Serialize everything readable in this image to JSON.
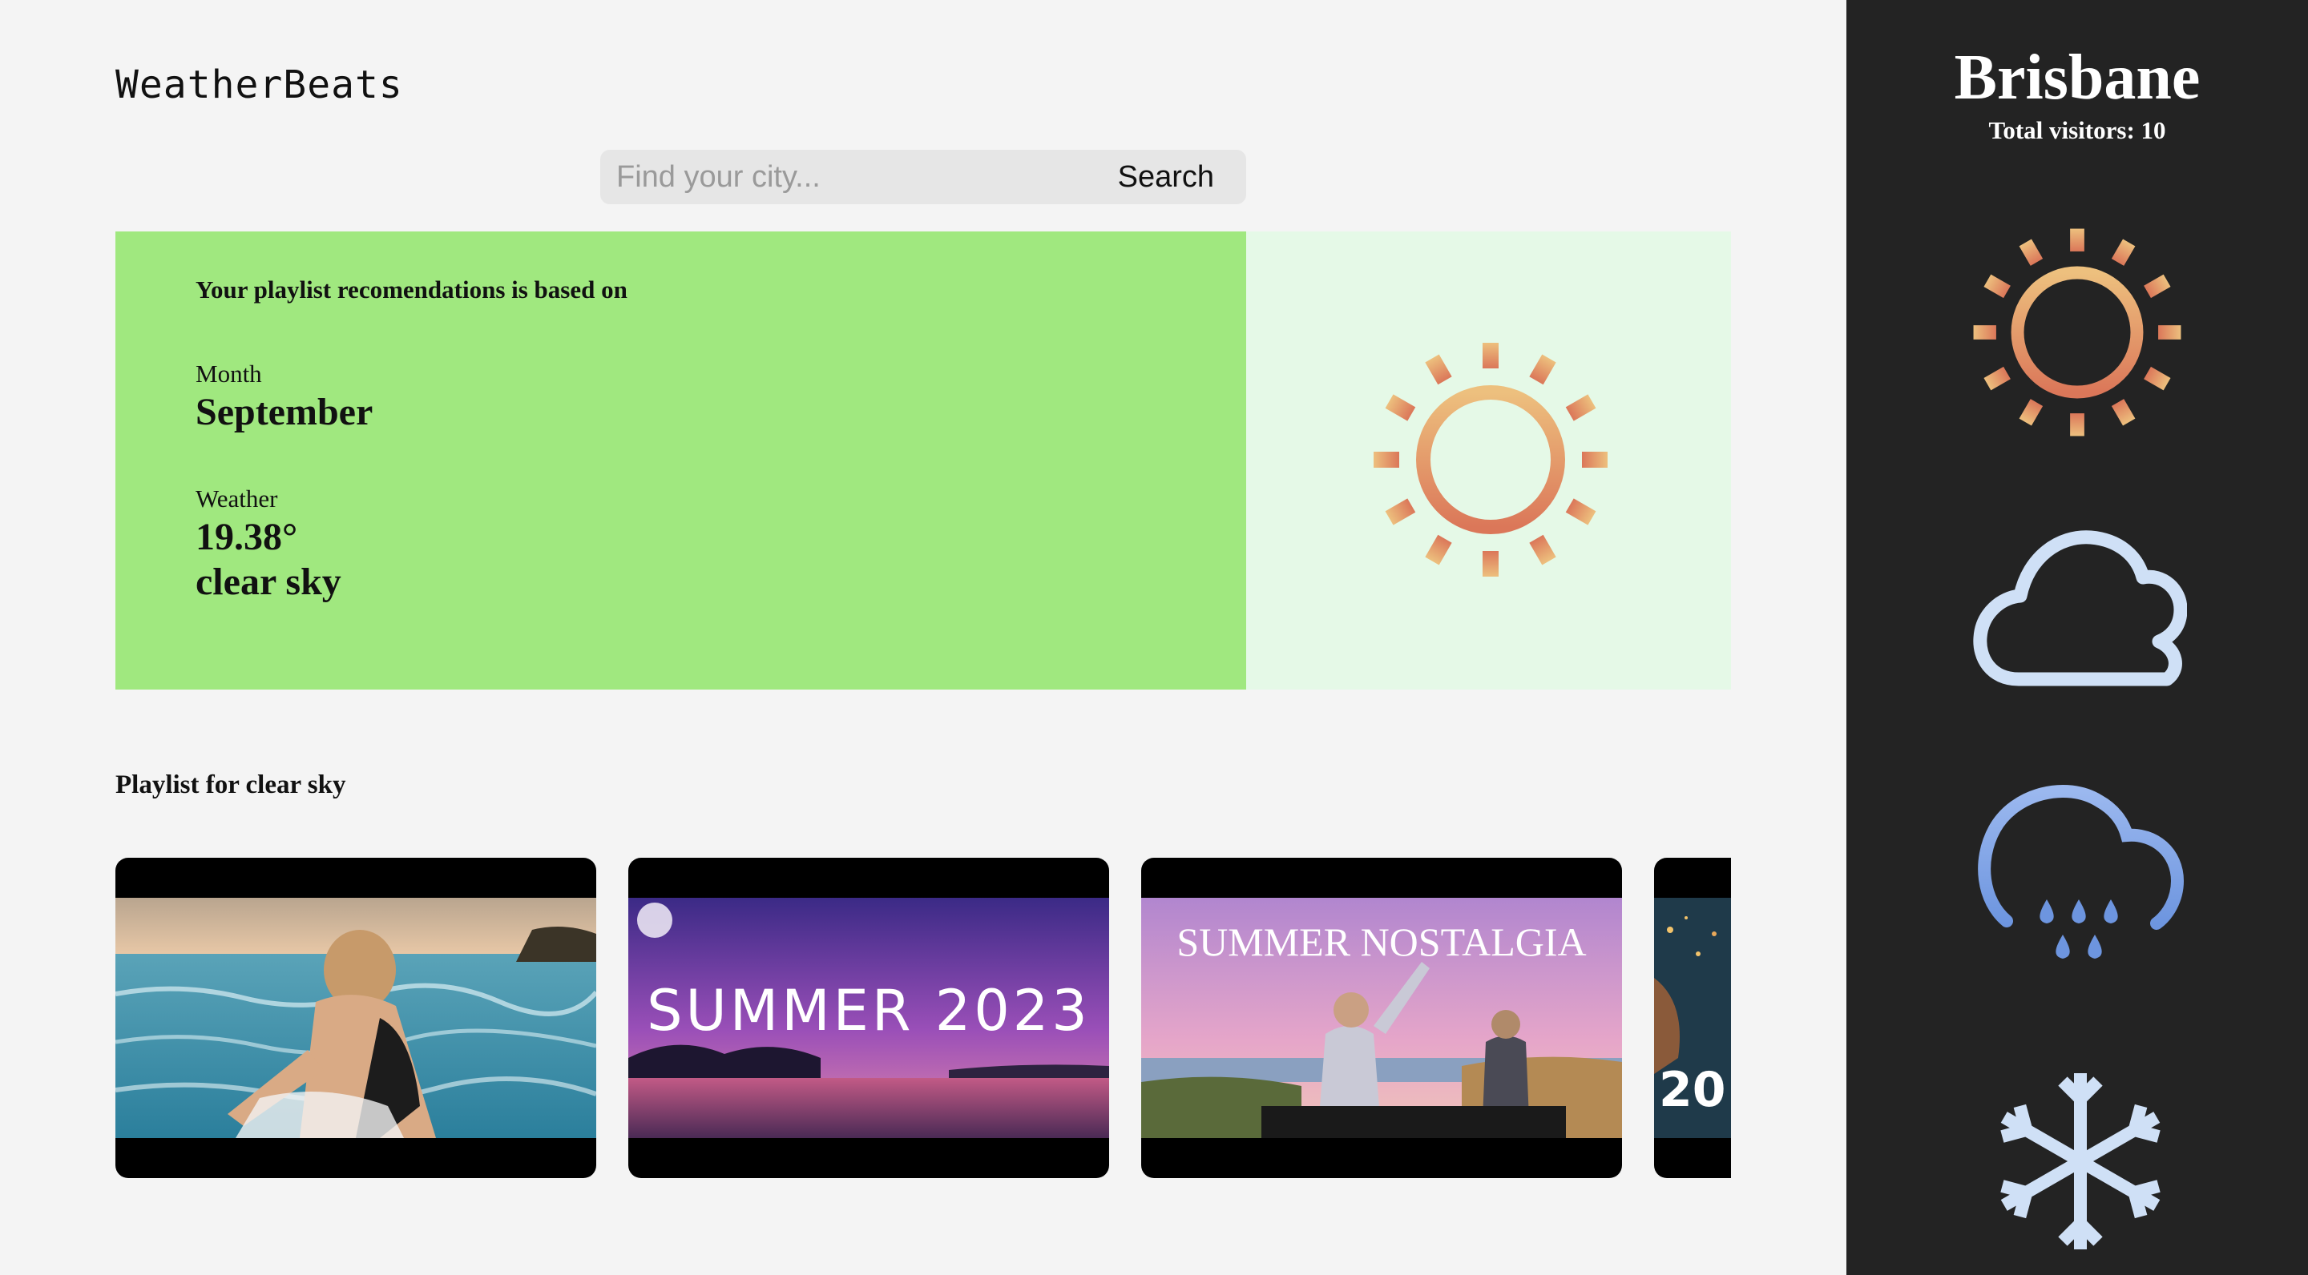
{
  "app": {
    "title": "WeatherBeats"
  },
  "search": {
    "placeholder": "Find your city...",
    "value": "",
    "button_label": "Search"
  },
  "info": {
    "heading": "Your playlist recomendations is based on",
    "month_label": "Month",
    "month_value": "September",
    "weather_label": "Weather",
    "temperature": "19.38°",
    "condition": "clear sky",
    "icon": "sun-icon",
    "panel_color": "#a0e87f"
  },
  "playlist": {
    "title": "Playlist for clear sky",
    "videos": [
      {
        "thumbnail": "ocean-swimmer-thumbnail",
        "overlay_text": ""
      },
      {
        "thumbnail": "summer-2023-thumbnail",
        "overlay_text": "SUMMER 2023"
      },
      {
        "thumbnail": "summer-nostalgia-thumbnail",
        "overlay_text": "SUMMER NOSTALGIA"
      },
      {
        "thumbnail": "partial-thumbnail",
        "overlay_text": "20"
      }
    ]
  },
  "sidebar": {
    "city": "Brisbane",
    "visitors_text": "Total visitors: 10",
    "icons": [
      "sun-icon",
      "cloud-icon",
      "rain-icon",
      "snowflake-icon"
    ]
  }
}
